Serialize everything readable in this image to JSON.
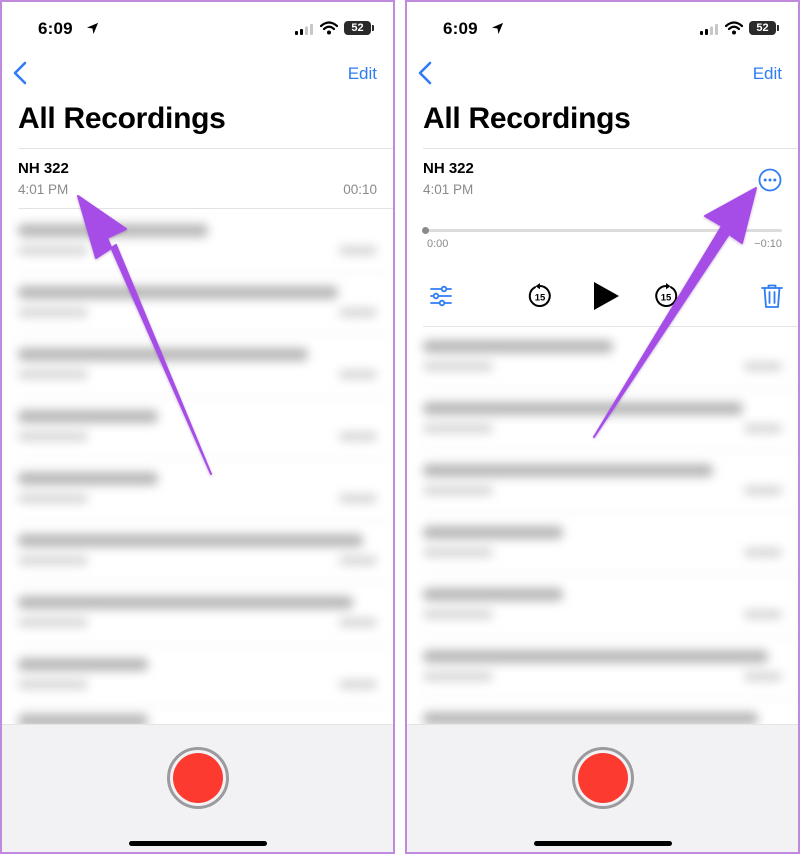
{
  "status_bar": {
    "time": "6:09",
    "battery": "52"
  },
  "nav": {
    "edit_label": "Edit"
  },
  "page": {
    "title": "All Recordings"
  },
  "recording": {
    "name": "NH 322",
    "time": "4:01 PM",
    "duration": "00:10",
    "elapsed": "0:00",
    "remaining": "−0:10",
    "progress": 0
  },
  "controls": {
    "skip_back_seconds": "15",
    "skip_forward_seconds": "15"
  },
  "icons": {
    "back": "chevron-left-icon",
    "more": "ellipsis-circle-icon",
    "options": "sliders-icon",
    "skip_back": "gobackward-15-icon",
    "play": "play-icon",
    "skip_forward": "goforward-15-icon",
    "delete": "trash-icon"
  },
  "colors": {
    "accent": "#2f7cf6",
    "record": "#fd3a30",
    "annotation_arrow": "#a64ee8",
    "panel_border": "#c189dd"
  }
}
